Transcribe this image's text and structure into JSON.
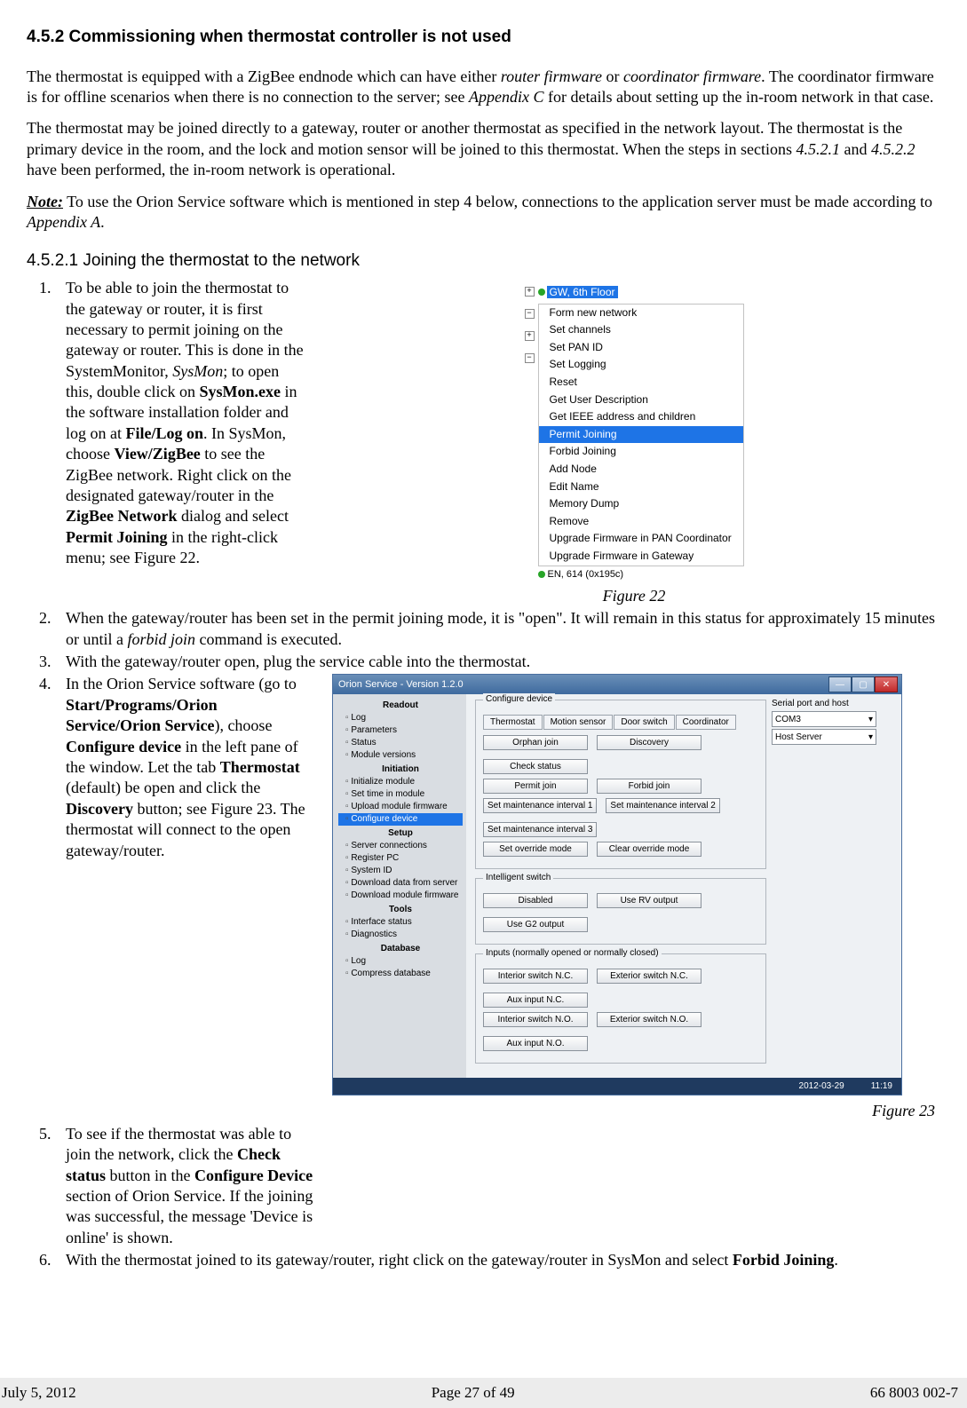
{
  "section_title": "4.5.2 Commissioning when thermostat controller is not used",
  "para1": "The thermostat is equipped with a ZigBee endnode which can have either ",
  "para1_ital1": "router firmware",
  "para1_mid": " or ",
  "para1_ital2": "coordinator firmware",
  "para1_tail": ". The coordinator firmware is for offline scenarios when there is no connection to the server; see ",
  "para1_ital3": "Appendix C",
  "para1_end": " for details about setting up the in-room network in that case.",
  "para2_a": "The thermostat may be joined directly to a gateway, router or another thermostat as specified in the network layout. The thermostat is the primary device in the room, and the lock and motion sensor will be joined to this thermostat. When the steps in sections ",
  "para2_ital1": "4.5.2.1",
  "para2_b": " and ",
  "para2_ital2": "4.5.2.2",
  "para2_c": " have been performed, the in-room network is operational.",
  "note_label": "Note:",
  "note_text_a": " To use the Orion Service software which is mentioned in step 4 below, connections to the application server must be made according to ",
  "note_ital": "Appendix A",
  "note_text_b": ".",
  "subsection_title": "4.5.2.1 Joining the thermostat to the network",
  "steps": {
    "s1": {
      "pre": "To be able to join the thermostat to the gateway or router, it is first necessary to permit joining on the gateway or router. This is done in the SystemMonitor, ",
      "ital1": "SysMon",
      "mid1": "; to open this, double click on ",
      "b1": "SysMon.exe",
      "mid2": " in the software installation folder and log on at ",
      "b2": "File/Log on",
      "mid3": ". In SysMon, choose ",
      "b3": "View/ZigBee",
      "mid4": " to see the ZigBee network. Right click on the designated gateway/router in the ",
      "b4": "ZigBee Network",
      "mid5": " dialog and select ",
      "b5": "Permit Joining",
      "tail": " in the right-click menu; see Figure 22."
    },
    "s2": {
      "a": "When the gateway/router has been set in the permit joining mode, it is \"open\". It will remain in this status for approximately 15 minutes or until a ",
      "ital": "forbid join",
      "b": " command is executed."
    },
    "s3": "With the gateway/router open, plug the service cable into the thermostat.",
    "s4": {
      "a": "In the Orion Service software (go to ",
      "b1": "Start/Programs/Orion Service/Orion Service",
      "b": "), choose ",
      "b2": "Configure device",
      "c": " in the left pane of the window. Let the tab ",
      "b3": "Thermostat",
      "d": " (default) be open and click the ",
      "b4": "Discovery",
      "e": " button; see Figure 23. The thermostat will connect to the open gateway/router."
    },
    "s5": {
      "a": "To see if the thermostat was able to join the network, click the ",
      "b1": "Check status",
      "b": " button in the ",
      "b2": "Configure Device",
      "c": " section of Orion Service. If the joining was successful, the message 'Device is online' is shown."
    },
    "s6": {
      "a": "With the thermostat joined to its gateway/router, right click on the gateway/router in SysMon and select ",
      "b1": "Forbid Joining",
      "b": "."
    }
  },
  "fig22": {
    "tree_label": "GW, 6th Floor",
    "menu": [
      "Form new network",
      "Set channels",
      "Set PAN ID",
      "Set Logging",
      "Reset",
      "Get User Description",
      "Get IEEE address and children",
      "Permit Joining",
      "Forbid Joining",
      "Add Node",
      "Edit Name",
      "Memory Dump",
      "Remove",
      "Upgrade Firmware in PAN Coordinator",
      "Upgrade Firmware in Gateway"
    ],
    "highlight_index": 7,
    "en_row": "EN, 614 (0x195c)",
    "caption": "Figure 22"
  },
  "fig23": {
    "title": "Orion Service - Version 1.2.0",
    "sidebar": {
      "groups": [
        {
          "title": "Readout",
          "items": [
            "Log",
            "Parameters",
            "Status",
            "Module versions"
          ]
        },
        {
          "title": "Initiation",
          "items": [
            "Initialize module",
            "Set time in module",
            "Upload module firmware",
            "Configure device"
          ],
          "hl_index": 3
        },
        {
          "title": "Setup",
          "items": [
            "Server connections",
            "Register PC",
            "System ID",
            "Download data from server",
            "Download module firmware"
          ]
        },
        {
          "title": "Tools",
          "items": [
            "Interface status",
            "Diagnostics"
          ]
        },
        {
          "title": "Database",
          "items": [
            "Log",
            "Compress database"
          ]
        }
      ]
    },
    "config_legend": "Configure device",
    "tabs": [
      "Thermostat",
      "Motion sensor",
      "Door switch",
      "Coordinator"
    ],
    "rows_config": [
      [
        "Orphan join",
        "Discovery",
        "Check status"
      ],
      [
        "Permit join",
        "Forbid join"
      ],
      [
        "Set maintenance interval 1",
        "Set maintenance interval 2",
        "Set maintenance interval 3"
      ],
      [
        "Set override mode",
        "Clear override mode"
      ]
    ],
    "switch_legend": "Intelligent switch",
    "rows_switch": [
      [
        "Disabled",
        "Use RV output",
        "Use G2 output"
      ]
    ],
    "inputs_legend": "Inputs (normally opened or normally closed)",
    "rows_inputs": [
      [
        "Interior switch N.C.",
        "Exterior switch N.C.",
        "Aux input N.C."
      ],
      [
        "Interior switch N.O.",
        "Exterior switch N.O.",
        "Aux input N.O."
      ]
    ],
    "right": {
      "label": "Serial port and host",
      "com": "COM3",
      "host": "Host Server"
    },
    "status_date": "2012-03-29",
    "status_time": "11:19",
    "caption": "Figure 23"
  },
  "footer": {
    "date": "July 5, 2012",
    "page": "Page 27 of 49",
    "doc": "66 8003 002-7"
  }
}
